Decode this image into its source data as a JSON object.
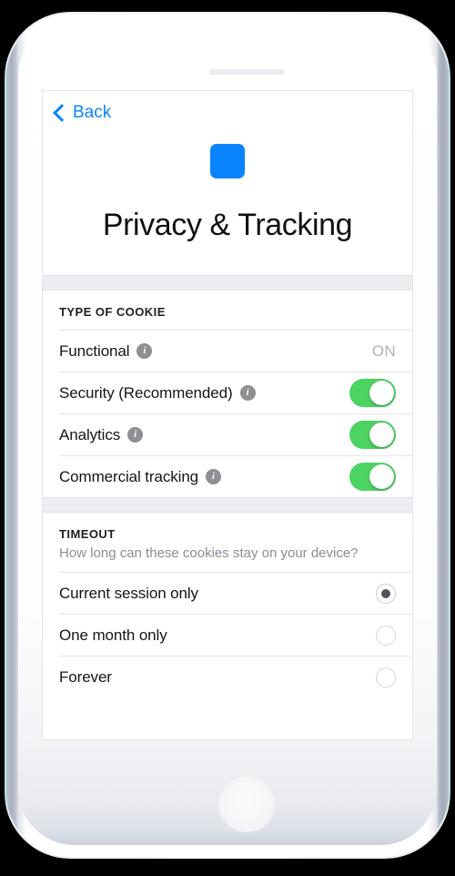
{
  "device": {
    "speaker_icon": "speaker-grille",
    "home_button_icon": "home-button"
  },
  "nav": {
    "back_label": "Back",
    "back_icon": "chevron-left-icon"
  },
  "header": {
    "app_icon": "app-icon",
    "title": "Privacy & Tracking",
    "accent_color": "#0a84ff"
  },
  "cookies_section": {
    "title": "TYPE OF COOKIE",
    "rows": [
      {
        "label": "Functional",
        "info_icon": "info-icon",
        "control": "value",
        "value": "ON"
      },
      {
        "label": "Security (Recommended)",
        "info_icon": "info-icon",
        "control": "toggle",
        "state": "on"
      },
      {
        "label": "Analytics",
        "info_icon": "info-icon",
        "control": "toggle",
        "state": "on"
      },
      {
        "label": "Commercial tracking",
        "info_icon": "info-icon",
        "control": "toggle",
        "state": "on"
      }
    ]
  },
  "timeout_section": {
    "title": "TIMEOUT",
    "subtitle": "How long can these cookies stay on your device?",
    "options": [
      {
        "label": "Current session only",
        "selected": true
      },
      {
        "label": "One month only",
        "selected": false
      },
      {
        "label": "Forever",
        "selected": false
      }
    ]
  },
  "colors": {
    "toggle_on": "#4cd362",
    "toggle_off": "#e9e9eb",
    "accent_blue": "#0a84ff",
    "value_gray": "#b2b3b8",
    "section_gap": "#eceef2",
    "radio_dot": "#51535c"
  }
}
